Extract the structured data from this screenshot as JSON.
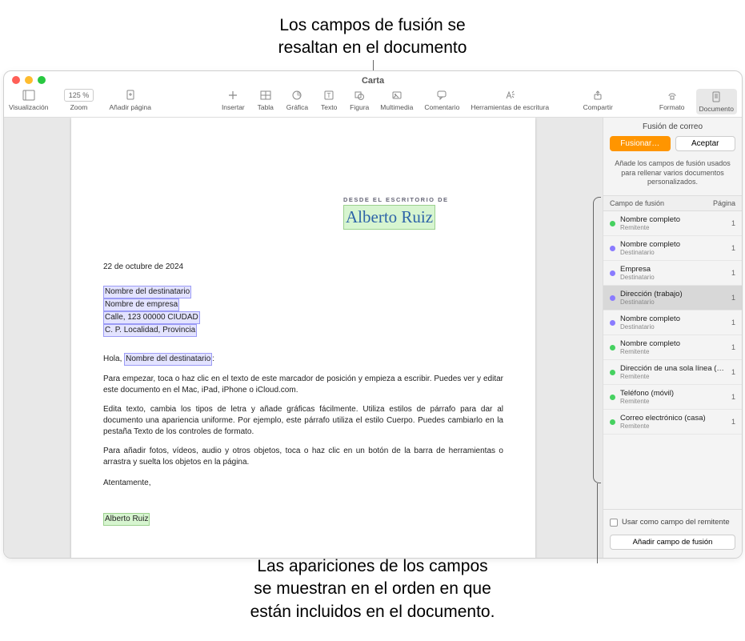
{
  "callouts": {
    "top_line1": "Los campos de fusión se",
    "top_line2": "resaltan en el documento",
    "bottom_line1": "Las apariciones de los campos",
    "bottom_line2": "se muestran en el orden en que",
    "bottom_line3": "están incluidos en el documento."
  },
  "window": {
    "title": "Carta"
  },
  "toolbar": {
    "visualizacion": "Visualización",
    "zoom_value": "125 %",
    "zoom": "Zoom",
    "anadir_pagina": "Añadir página",
    "insertar": "Insertar",
    "tabla": "Tabla",
    "grafica": "Gráfica",
    "texto": "Texto",
    "figura": "Figura",
    "multimedia": "Multimedia",
    "comentario": "Comentario",
    "herramientas": "Herramientas de escritura",
    "compartir": "Compartir",
    "formato": "Formato",
    "documento": "Documento"
  },
  "doc": {
    "letterhead_label": "DESDE EL ESCRITORIO DE",
    "letterhead_name": "Alberto Ruiz",
    "date": "22 de octubre de 2024",
    "addr1": "Nombre del destinatario",
    "addr2": "Nombre de empresa",
    "addr3": "Calle, 123 00000 CIUDAD",
    "addr4": "C. P. Localidad, Provincia",
    "greeting_prefix": "Hola, ",
    "greeting_field": "Nombre del destinatario",
    "greeting_suffix": ":",
    "p1": "Para empezar, toca o haz clic en el texto de este marcador de posición y empieza a escribir. Puedes ver y editar este documento en el Mac, iPad, iPhone o iCloud.com.",
    "p2": "Edita texto, cambia los tipos de letra y añade gráficas fácilmente. Utiliza estilos de párrafo para dar al documento una apariencia uniforme. Por ejemplo, este párrafo utiliza el estilo Cuerpo. Puedes cambiarlo en la pestaña Texto de los controles de formato.",
    "p3": "Para añadir fotos, vídeos, audio y otros objetos, toca o haz clic en un botón de la barra de herramientas o arrastra y suelta los objetos en la página.",
    "signoff": "Atentamente,",
    "signature": "Alberto Ruiz"
  },
  "inspector": {
    "title": "Fusión de correo",
    "merge_btn": "Fusionar…",
    "accept_btn": "Aceptar",
    "desc": "Añade los campos de fusión usados para rellenar varios documentos personalizados.",
    "col_field": "Campo de fusión",
    "col_page": "Página",
    "fields": [
      {
        "color": "green",
        "name": "Nombre completo",
        "sub": "Remitente",
        "page": "1",
        "sel": false
      },
      {
        "color": "purple",
        "name": "Nombre completo",
        "sub": "Destinatario",
        "page": "1",
        "sel": false
      },
      {
        "color": "purple",
        "name": "Empresa",
        "sub": "Destinatario",
        "page": "1",
        "sel": false
      },
      {
        "color": "purple",
        "name": "Dirección (trabajo)",
        "sub": "Destinatario",
        "page": "1",
        "sel": true
      },
      {
        "color": "purple",
        "name": "Nombre completo",
        "sub": "Destinatario",
        "page": "1",
        "sel": false
      },
      {
        "color": "green",
        "name": "Nombre completo",
        "sub": "Remitente",
        "page": "1",
        "sel": false
      },
      {
        "color": "green",
        "name": "Dirección de una sola línea (Casa)",
        "sub": "Remitente",
        "page": "1",
        "sel": false
      },
      {
        "color": "green",
        "name": "Teléfono (móvil)",
        "sub": "Remitente",
        "page": "1",
        "sel": false
      },
      {
        "color": "green",
        "name": "Correo electrónico (casa)",
        "sub": "Remitente",
        "page": "1",
        "sel": false
      }
    ],
    "use_as_sender": "Usar como campo del remitente",
    "add_field": "Añadir campo de fusión"
  }
}
